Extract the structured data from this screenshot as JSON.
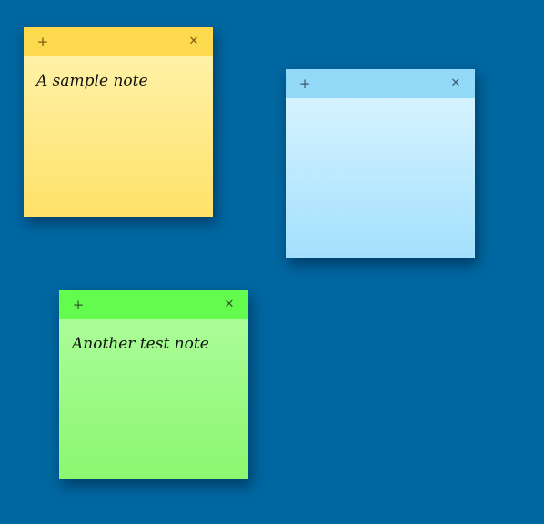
{
  "colors": {
    "desktop_background": "#0067a0",
    "yellow_bar": "#fdd94e",
    "yellow_body": "#fff1a6",
    "blue_bar": "#92d9f8",
    "blue_body": "#d5f3ff",
    "green_bar": "#63fb4d",
    "green_body": "#aafc98"
  },
  "notes": [
    {
      "color": "yellow",
      "add_icon": "plus-icon",
      "add_glyph": "+",
      "close_icon": "close-icon",
      "close_glyph": "✕",
      "text": "A sample note"
    },
    {
      "color": "blue",
      "add_icon": "plus-icon",
      "add_glyph": "+",
      "close_icon": "close-icon",
      "close_glyph": "✕",
      "text": ""
    },
    {
      "color": "green",
      "add_icon": "plus-icon",
      "add_glyph": "+",
      "close_icon": "close-icon",
      "close_glyph": "✕",
      "text": "Another test note"
    }
  ]
}
